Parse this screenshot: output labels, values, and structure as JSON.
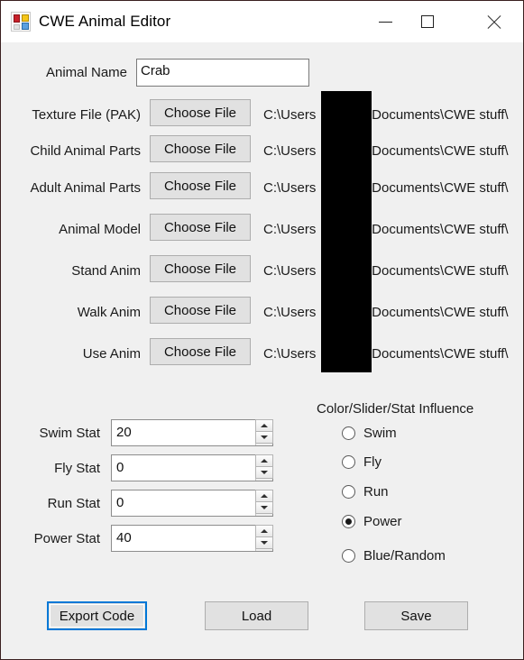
{
  "window": {
    "title": "CWE Animal Editor",
    "icon": "winforms-app-icon",
    "caption_buttons": [
      {
        "name": "minimize-button",
        "glyph": "minimize-icon"
      },
      {
        "name": "maximize-button",
        "glyph": "maximize-icon"
      },
      {
        "name": "close-button",
        "glyph": "close-icon"
      }
    ]
  },
  "colors": {
    "window_background": "#f0f0f0",
    "titlebar_background": "#ffffff",
    "focus_accent": "#0078d7",
    "redaction": "#000000"
  },
  "animal_name": {
    "label": "Animal Name",
    "value": "Crab",
    "placeholder": ""
  },
  "file_rows": [
    {
      "label": "Texture File (PAK)",
      "button": "Choose File",
      "path_prefix": "C:\\Users",
      "path_suffix": "\\Documents\\CWE stuff\\"
    },
    {
      "label": "Child Animal Parts",
      "button": "Choose File",
      "path_prefix": "C:\\Users",
      "path_suffix": "\\Documents\\CWE stuff\\"
    },
    {
      "label": "Adult Animal Parts",
      "button": "Choose File",
      "path_prefix": "C:\\Users",
      "path_suffix": "\\Documents\\CWE stuff\\"
    },
    {
      "label": "Animal Model",
      "button": "Choose File",
      "path_prefix": "C:\\Users",
      "path_suffix": "\\Documents\\CWE stuff\\"
    },
    {
      "label": "Stand Anim",
      "button": "Choose File",
      "path_prefix": "C:\\Users",
      "path_suffix": "\\Documents\\CWE stuff\\"
    },
    {
      "label": "Walk Anim",
      "button": "Choose File",
      "path_prefix": "C:\\Users",
      "path_suffix": "\\Documents\\CWE stuff\\"
    },
    {
      "label": "Use Anim",
      "button": "Choose File",
      "path_prefix": "C:\\Users",
      "path_suffix": "\\Documents\\CWE stuff\\"
    }
  ],
  "stats": [
    {
      "label": "Swim Stat",
      "value": "20"
    },
    {
      "label": "Fly Stat",
      "value": "0"
    },
    {
      "label": "Run Stat",
      "value": "0"
    },
    {
      "label": "Power Stat",
      "value": "40"
    }
  ],
  "influence": {
    "title": "Color/Slider/Stat Influence",
    "options": [
      {
        "label": "Swim",
        "selected": false
      },
      {
        "label": "Fly",
        "selected": false
      },
      {
        "label": "Run",
        "selected": false
      },
      {
        "label": "Power",
        "selected": true
      },
      {
        "label": "Blue/Random",
        "selected": false
      }
    ]
  },
  "actions": [
    {
      "label": "Export Code",
      "focused": true
    },
    {
      "label": "Load",
      "focused": false
    },
    {
      "label": "Save",
      "focused": false
    }
  ]
}
